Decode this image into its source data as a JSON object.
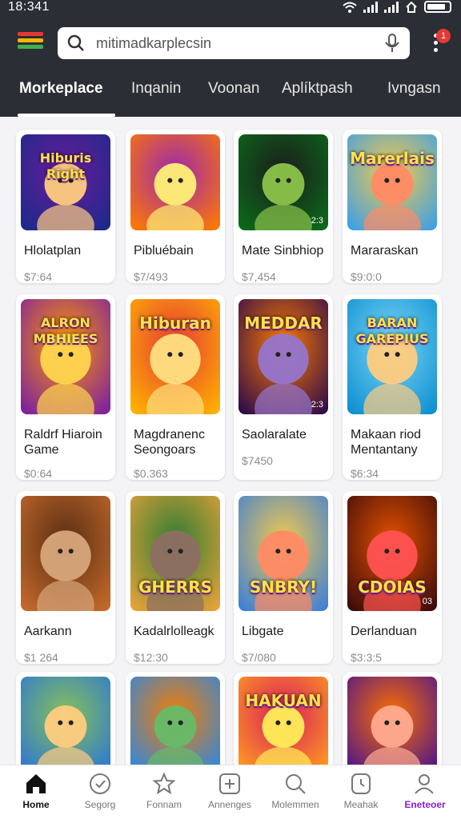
{
  "status_bar": {
    "time": "18:341"
  },
  "search": {
    "value": "mitimadkarplecsin"
  },
  "notifications": {
    "count": "1"
  },
  "tabs": [
    {
      "label": "Morkeplace"
    },
    {
      "label": "Inqanin"
    },
    {
      "label": "Voonan"
    },
    {
      "label": "Aplíktpash"
    },
    {
      "label": "Ivngasn"
    }
  ],
  "products": [
    {
      "title": "Hlolatplan",
      "price": "$7:64",
      "art": "Hiburis\nRight",
      "badge": ""
    },
    {
      "title": "Pibluébain",
      "price": "$7/493",
      "art": "",
      "badge": ""
    },
    {
      "title": "Mate Sinbhiop",
      "price": "$7,454",
      "art": "",
      "badge": "2:3"
    },
    {
      "title": "Mararaskan",
      "price": "$9:0:0",
      "art": "Marerlais",
      "badge": ""
    },
    {
      "title": "Raldrf Hiaroin\nGame",
      "price": "$0:64",
      "art": "ALRON\nMBHIEES",
      "badge": ""
    },
    {
      "title": "Magdranenc\nSeongoars",
      "price": "$0.363",
      "art": "Hiburan",
      "badge": ""
    },
    {
      "title": "Saolaralate",
      "price": "$7450",
      "art": "MEDDAR",
      "badge": "2:3"
    },
    {
      "title": "Makaan riod\nMentantany",
      "price": "$6:34",
      "art": "BARAN\nGAREPIUS",
      "badge": ""
    },
    {
      "title": "Aarkann",
      "price": "$1 264",
      "art": "",
      "badge": ""
    },
    {
      "title": "Kadalrlolleagk",
      "price": "$12:30",
      "art": "GHERRS",
      "badge": ""
    },
    {
      "title": "Libgate",
      "price": "$7/080",
      "art": "SNBRY!",
      "badge": ""
    },
    {
      "title": "Derlanduan",
      "price": "$3:3:5",
      "art": "CDOIAS",
      "badge": "03"
    },
    {
      "title": "",
      "price": "",
      "art": "",
      "badge": ""
    },
    {
      "title": "",
      "price": "",
      "art": "",
      "badge": ""
    },
    {
      "title": "",
      "price": "",
      "art": "HAKUAN",
      "badge": ""
    },
    {
      "title": "",
      "price": "",
      "art": "",
      "badge": ""
    }
  ],
  "bottom_nav": [
    {
      "label": "Home",
      "icon": "home-icon"
    },
    {
      "label": "Segorg",
      "icon": "check-circle-icon"
    },
    {
      "label": "Fonnam",
      "icon": "star-icon"
    },
    {
      "label": "Annenges",
      "icon": "plus-box-icon"
    },
    {
      "label": "Molemmen",
      "icon": "search-icon"
    },
    {
      "label": "Meahak",
      "icon": "timer-icon"
    },
    {
      "label": "Eneteoer",
      "icon": "user-icon"
    }
  ],
  "colors": {
    "header_bg": "#2b2e35",
    "accent": "#8a1dd6",
    "notification": "#e53935"
  }
}
